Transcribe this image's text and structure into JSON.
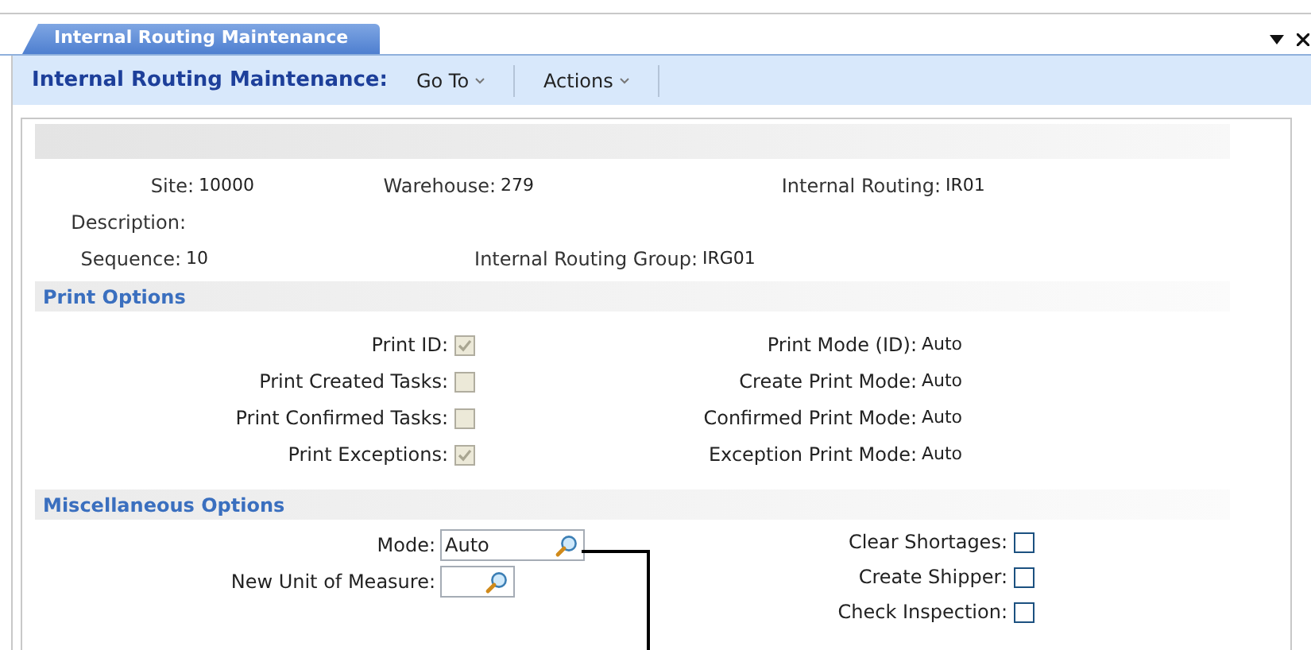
{
  "tab": {
    "label": "Internal Routing Maintenance",
    "selected": true
  },
  "toolbar": {
    "title": "Internal Routing Maintenance:",
    "menus": [
      {
        "label": "Go To"
      },
      {
        "label": "Actions"
      }
    ]
  },
  "header_rows": [
    [
      {
        "label": "Site:",
        "value": "10000"
      },
      {
        "label": "Warehouse:",
        "value": "279"
      },
      {
        "label": "Internal Routing:",
        "value": "IR01"
      }
    ],
    [
      {
        "label": "Description:"
      }
    ],
    [
      {
        "label": "Sequence:",
        "value": "10"
      },
      {
        "label": "Internal Routing Group:",
        "value": "IRG01"
      }
    ]
  ],
  "print_options": {
    "title": "Print Options",
    "rows": [
      {
        "checkbox": {
          "label": "Print ID:",
          "checked": true,
          "disabled": true
        },
        "mode": {
          "label": "Print Mode (ID):",
          "value": "Auto"
        }
      },
      {
        "checkbox": {
          "label": "Print Created Tasks:",
          "checked": false,
          "disabled": true
        },
        "mode": {
          "label": "Create Print Mode:",
          "value": "Auto"
        }
      },
      {
        "checkbox": {
          "label": "Print Confirmed Tasks:",
          "checked": false,
          "disabled": true
        },
        "mode": {
          "label": "Confirmed Print Mode:",
          "value": "Auto"
        }
      },
      {
        "checkbox": {
          "label": "Print Exceptions:",
          "checked": true,
          "disabled": true
        },
        "mode": {
          "label": "Exception Print Mode:",
          "value": "Auto"
        }
      }
    ]
  },
  "misc_options": {
    "title": "Miscellaneous Options",
    "lookups": [
      {
        "label": "Mode:",
        "value": "Auto"
      },
      {
        "label": "New Unit of Measure:"
      }
    ],
    "checkboxes": [
      {
        "label": "Clear Shortages:",
        "checked": false,
        "disabled": false
      },
      {
        "label": "Create Shipper:",
        "checked": false,
        "disabled": false
      },
      {
        "label": "Check Inspection:",
        "checked": false,
        "disabled": false
      }
    ]
  }
}
